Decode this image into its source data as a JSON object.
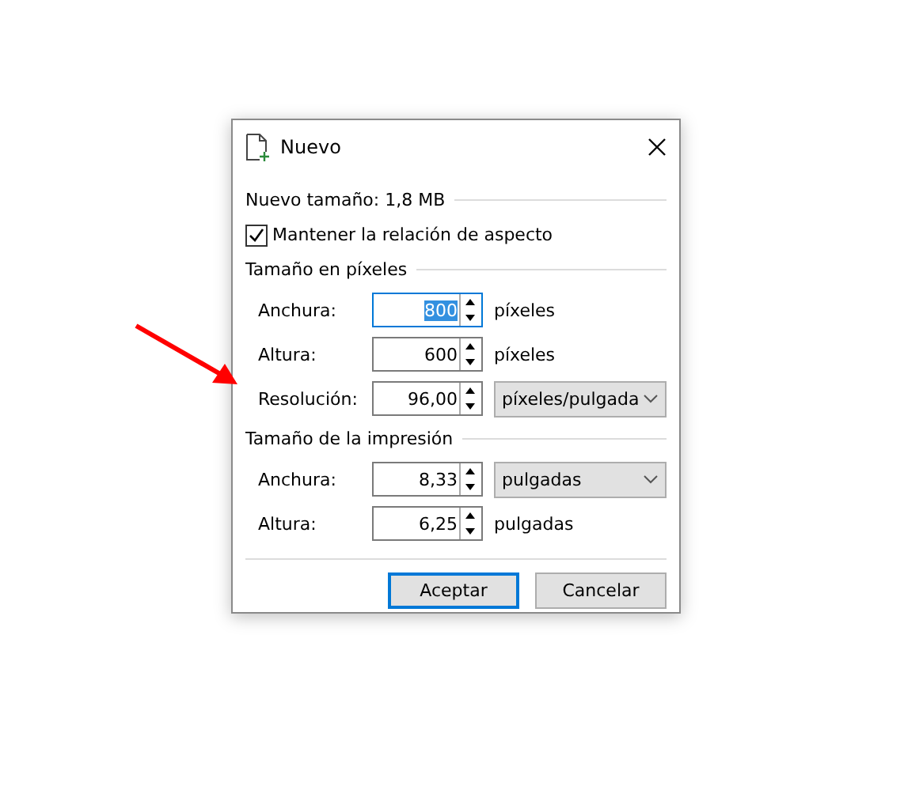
{
  "window": {
    "title": "Nuevo"
  },
  "new_size": "Nuevo tamaño: 1,8 MB",
  "keep_aspect": {
    "label": "Mantener la relación de aspecto",
    "checked": true
  },
  "sections": [
    {
      "title": "Tamaño en píxeles",
      "rows": [
        {
          "label": "Anchura:",
          "value": "800",
          "focused": true,
          "unit": {
            "kind": "text",
            "label": "píxeles"
          }
        },
        {
          "label": "Altura:",
          "value": "600",
          "focused": false,
          "unit": {
            "kind": "text",
            "label": "píxeles"
          }
        },
        {
          "label": "Resolución:",
          "value": "96,00",
          "focused": false,
          "unit": {
            "kind": "dropdown",
            "label": "píxeles/pulgada"
          }
        }
      ]
    },
    {
      "title": "Tamaño de la impresión",
      "rows": [
        {
          "label": "Anchura:",
          "value": "8,33",
          "focused": false,
          "unit": {
            "kind": "dropdown",
            "label": "pulgadas"
          }
        },
        {
          "label": "Altura:",
          "value": "6,25",
          "focused": false,
          "unit": {
            "kind": "text",
            "label": "pulgadas"
          }
        }
      ]
    }
  ],
  "buttons": [
    {
      "label": "Aceptar",
      "default": true
    },
    {
      "label": "Cancelar",
      "default": false
    }
  ]
}
